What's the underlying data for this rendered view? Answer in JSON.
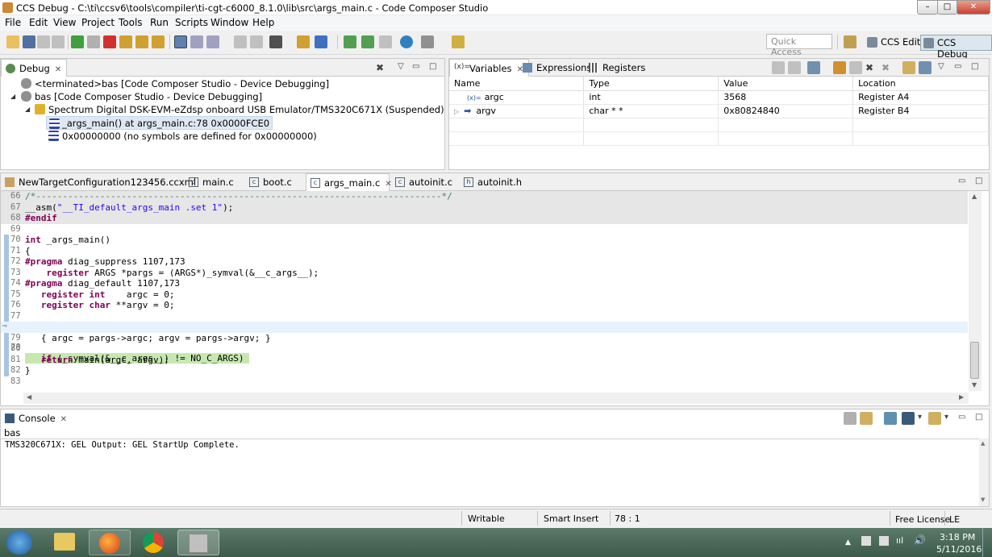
{
  "window": {
    "title": "CCS Debug - C:\\ti\\ccsv6\\tools\\compiler\\ti-cgt-c6000_8.1.0\\lib\\src\\args_main.c - Code Composer Studio"
  },
  "menu": [
    "File",
    "Edit",
    "View",
    "Project",
    "Tools",
    "Run",
    "Scripts",
    "Window",
    "Help"
  ],
  "toolbar": {
    "quick_access_placeholder": "Quick Access",
    "perspective_edit": "CCS Edit",
    "perspective_debug": "CCS Debug"
  },
  "debug": {
    "tab": "Debug",
    "rows": [
      "<terminated>bas [Code Composer Studio - Device Debugging]",
      "bas [Code Composer Studio - Device Debugging]",
      "Spectrum Digital DSK-EVM-eZdsp onboard USB Emulator/TMS320C671X (Suspended)",
      "_args_main() at args_main.c:78 0x0000FCE0",
      "0x00000000  (no symbols are defined for 0x00000000)"
    ]
  },
  "variables": {
    "tabs": [
      "Variables",
      "Expressions",
      "Registers"
    ],
    "columns": [
      "Name",
      "Type",
      "Value",
      "Location"
    ],
    "rows": [
      {
        "name": "argc",
        "type": "int",
        "value": "3568",
        "location": "Register A4"
      },
      {
        "name": "argv",
        "type": "char * *",
        "value": "0x80824840",
        "location": "Register B4"
      }
    ]
  },
  "editor": {
    "tabs": [
      "NewTargetConfiguration123456.ccxml",
      "main.c",
      "boot.c",
      "args_main.c",
      "autoinit.c",
      "autoinit.h"
    ],
    "active_tab": "args_main.c",
    "lines": [
      {
        "n": "66",
        "t": "/*----------------------------------------------------------------------------*/"
      },
      {
        "n": "67",
        "t": "__asm(\"__TI_default_args_main .set 1\");"
      },
      {
        "n": "68",
        "t": "#endif"
      },
      {
        "n": "69",
        "t": ""
      },
      {
        "n": "70",
        "t": "int _args_main()"
      },
      {
        "n": "71",
        "t": "{"
      },
      {
        "n": "72",
        "t": "#pragma diag_suppress 1107,173"
      },
      {
        "n": "73",
        "t": "    register ARGS *pargs = (ARGS*)_symval(&__c_args__);"
      },
      {
        "n": "74",
        "t": "#pragma diag_default 1107,173"
      },
      {
        "n": "75",
        "t": "   register int    argc = 0;"
      },
      {
        "n": "76",
        "t": "   register char **argv = 0;"
      },
      {
        "n": "77",
        "t": ""
      },
      {
        "n": "78",
        "t": "   if (_symval(&__c_args__) != NO_C_ARGS)"
      },
      {
        "n": "79",
        "t": "   { argc = pargs->argc; argv = pargs->argv; }"
      },
      {
        "n": "80",
        "t": ""
      },
      {
        "n": "81",
        "t": "   return main(argc, argv);"
      },
      {
        "n": "82",
        "t": "}"
      },
      {
        "n": "83",
        "t": ""
      }
    ]
  },
  "console": {
    "tab": "Console",
    "session": "bas",
    "output": "TMS320C671X: GEL Output: GEL StartUp Complete."
  },
  "status": {
    "mode": "Writable",
    "insert": "Smart Insert",
    "position": "78 : 1",
    "license": "Free License",
    "le": "LE"
  },
  "taskbar": {
    "time": "3:18 PM",
    "date": "5/11/2016"
  }
}
